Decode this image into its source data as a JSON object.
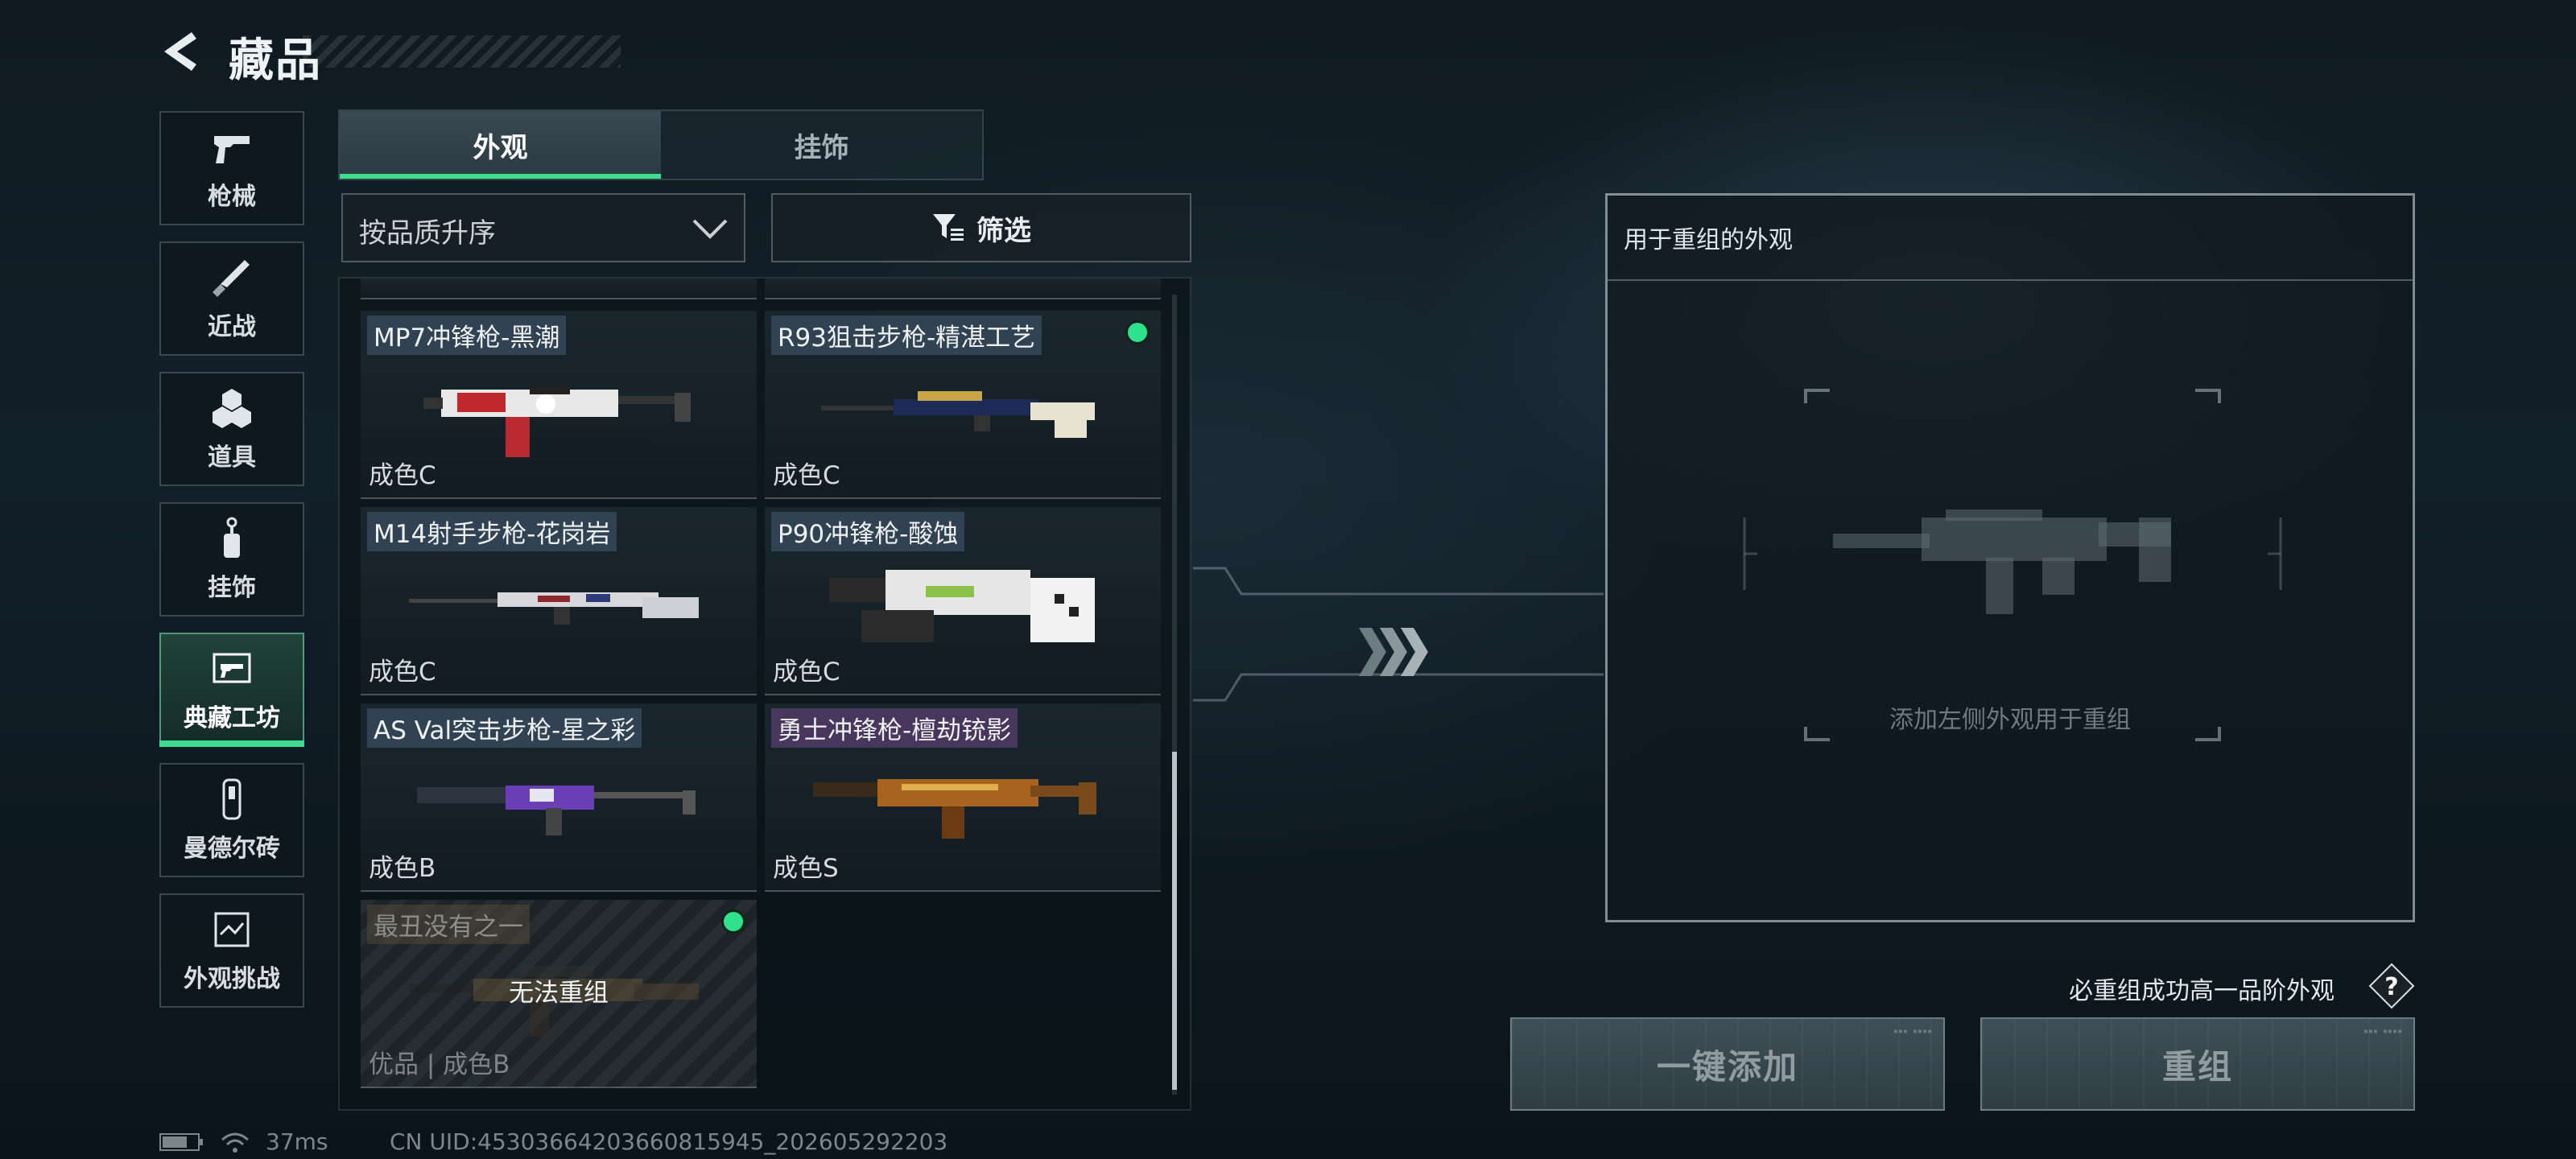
{
  "header": {
    "title": "藏品"
  },
  "nav": [
    {
      "label": "枪械",
      "icon": "pistol-icon"
    },
    {
      "label": "近战",
      "icon": "knife-icon"
    },
    {
      "label": "道具",
      "icon": "grenades-icon"
    },
    {
      "label": "挂饰",
      "icon": "charm-icon"
    },
    {
      "label": "典藏工坊",
      "icon": "workshop-icon",
      "active": true
    },
    {
      "label": "曼德尔砖",
      "icon": "brick-icon"
    },
    {
      "label": "外观挑战",
      "icon": "challenge-icon"
    }
  ],
  "tabs": [
    {
      "label": "外观",
      "active": true
    },
    {
      "label": "挂饰"
    }
  ],
  "sort": {
    "value": "按品质升序"
  },
  "filter": {
    "label": "筛选"
  },
  "cards": [
    {
      "name": "MP7冲锋枪-黑潮",
      "grade": "成色C"
    },
    {
      "name": "R93狙击步枪-精湛工艺",
      "grade": "成色C",
      "selected": true
    },
    {
      "name": "M14射手步枪-花岗岩",
      "grade": "成色C"
    },
    {
      "name": "P90冲锋枪-酸蚀",
      "grade": "成色C"
    },
    {
      "name": "AS Val突击步枪-星之彩",
      "grade": "成色B"
    },
    {
      "name": "勇士冲锋枪-檀劫铳影",
      "grade": "成色S"
    },
    {
      "name": "最丑没有之一",
      "grade": "优品 | 成色B",
      "locked_text": "无法重组",
      "selected": true
    }
  ],
  "recombine": {
    "title": "用于重组的外观",
    "hint": "添加左侧外观用于重组",
    "note": "必重组成功高一品阶外观"
  },
  "buttons": {
    "add_all": "一键添加",
    "recombine": "重组"
  },
  "status": {
    "ping": "37ms",
    "uid": "CN UID:4530366420366081594​5_202605292203"
  },
  "colors": {
    "accent": "#3fdc8e",
    "selected_dot": "#2fe08c"
  }
}
